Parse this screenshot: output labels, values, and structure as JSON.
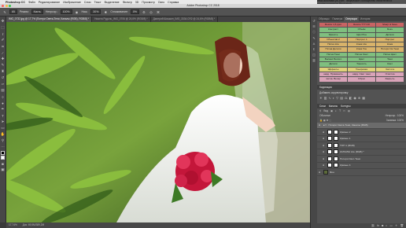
{
  "menubar": {
    "items": [
      "Photoshop CC",
      "Файл",
      "Редактирование",
      "Изображение",
      "Слои",
      "Текст",
      "Выделение",
      "Фильтр",
      "3D",
      "Просмотр",
      "Окно",
      "Справка"
    ],
    "right_text": "www.automate-ps.com: Творческое сообщество любителей и профессионалов Photoshop"
  },
  "window": {
    "title": "Adobe Photoshop CC 2018"
  },
  "options": {
    "brush_size": "65",
    "mode_label": "Режим:",
    "mode_value": "Кисть",
    "opacity_label": "Непрозр.:",
    "opacity_value": "100%",
    "pressure_label": "Наж.:",
    "pressure_value": "30%",
    "smoothing_label": "Сглаживание:",
    "smoothing_value": "0%"
  },
  "tabs": [
    {
      "label": "IMG_0732.jpg @ 17,7% (Потери Света-Тени, Каналы (RGB), RGB/8) *",
      "active": true
    },
    {
      "label": "Никита Рудоль_IMG_0706 @ 24,6% (RGB/8) *",
      "active": false
    },
    {
      "label": "Дмитрий Шишкин_IMG_3334.CR2 @ 24,6% (RGB/8) *",
      "active": false
    }
  ],
  "status": {
    "zoom": "17,74%",
    "doc": "Док: 69,5M/389,2M"
  },
  "panel": {
    "tabs": [
      "Образцы",
      "Палитра",
      "Операции",
      "История"
    ],
    "active_tab": "Операции",
    "actions": [
      {
        "label": "Resize 1,5 ppm",
        "color": "#c86464"
      },
      {
        "label": "Resize ??? CR",
        "color": "#c86464"
      },
      {
        "label": "Sharp & Save",
        "color": "#c86464"
      },
      {
        "label": "Контраст",
        "color": "#7fbf7f"
      },
      {
        "label": "Объём",
        "color": "#7fbf7f"
      },
      {
        "label": "Бокэ",
        "color": "#7fbf7f"
      },
      {
        "label": "Яркость",
        "color": "#7fbf7f"
      },
      {
        "label": "Цвет/Тон",
        "color": "#7fbf7f"
      },
      {
        "label": "Детали",
        "color": "#7fbf7f"
      },
      {
        "label": "Объектив 2",
        "color": "#d8b36a"
      },
      {
        "label": "Портрет 1",
        "color": "#d8b36a"
      },
      {
        "label": "Портрет",
        "color": "#d8b36a"
      },
      {
        "label": "Пятна Lite",
        "color": "#d8b36a"
      },
      {
        "label": "Кожа Lite",
        "color": "#d8b36a"
      },
      {
        "label": "Кожа",
        "color": "#d8b36a"
      },
      {
        "label": "Пятна Детали",
        "color": "#d8b36a"
      },
      {
        "label": "Кожа Тон",
        "color": "#d8b36a"
      },
      {
        "label": "Потери Св-Тени",
        "color": "#d8b36a"
      },
      {
        "label": "Пятна Тени",
        "color": "#7fbf7f"
      },
      {
        "label": "Пятна Свет",
        "color": "#7fbf7f"
      },
      {
        "label": "Пятна Цвет",
        "color": "#7fbf7f"
      },
      {
        "label": "Баланс Белого",
        "color": "#7fbf7f"
      },
      {
        "label": "Цвет",
        "color": "#7fbf7f"
      },
      {
        "label": "Тени",
        "color": "#7fbf7f"
      },
      {
        "label": "Детали",
        "color": "#7fbf7f"
      },
      {
        "label": "Тонкость",
        "color": "#7fbf7f"
      },
      {
        "label": "Свет",
        "color": "#7fbf7f"
      },
      {
        "label": "Эффекты",
        "color": "#e0d27a"
      },
      {
        "label": "Тонировка",
        "color": "#e0d27a"
      },
      {
        "label": "Чистота",
        "color": "#e0d27a"
      },
      {
        "label": "нард. Применить",
        "color": "#d9a3b8"
      },
      {
        "label": "нард. Свет тени",
        "color": "#d9a3b8"
      },
      {
        "label": "Очистка",
        "color": "#d9a3b8"
      },
      {
        "label": "числа. Вечер",
        "color": "#d9a3b8"
      },
      {
        "label": "Сброс",
        "color": "#d9a3b8"
      },
      {
        "label": "Закрыть",
        "color": "#d9a3b8"
      }
    ],
    "adjustments_header": "Коррекция",
    "adjustments_title": "Добавить корректировку",
    "layers_tabs": [
      "Слои",
      "Каналы",
      "Контуры"
    ],
    "layers_filter": "Вид",
    "layers_mode": "Обычные",
    "layers_opacity": "Непрозр.: 100%",
    "layers_fill": "Заливка: 100%",
    "layers": [
      {
        "name": "Потери Света-Тени, Каналы (RGB)",
        "type": "group",
        "selected": true
      },
      {
        "name": "Кривые 2",
        "type": "adjust",
        "selected": false
      },
      {
        "name": "Кривые 1",
        "type": "adjust",
        "selected": false
      },
      {
        "name": "TOH 1 (RGB)",
        "type": "adjust",
        "selected": false
      },
      {
        "name": "КАНАЛЫ Lite (RGB) *",
        "type": "adjust",
        "selected": false
      },
      {
        "name": "Потери Свет-Тени",
        "type": "pixel",
        "selected": false
      },
      {
        "name": "Кривые 4",
        "type": "adjust",
        "selected": false
      },
      {
        "name": "Фон",
        "type": "photo",
        "selected": false
      }
    ]
  }
}
